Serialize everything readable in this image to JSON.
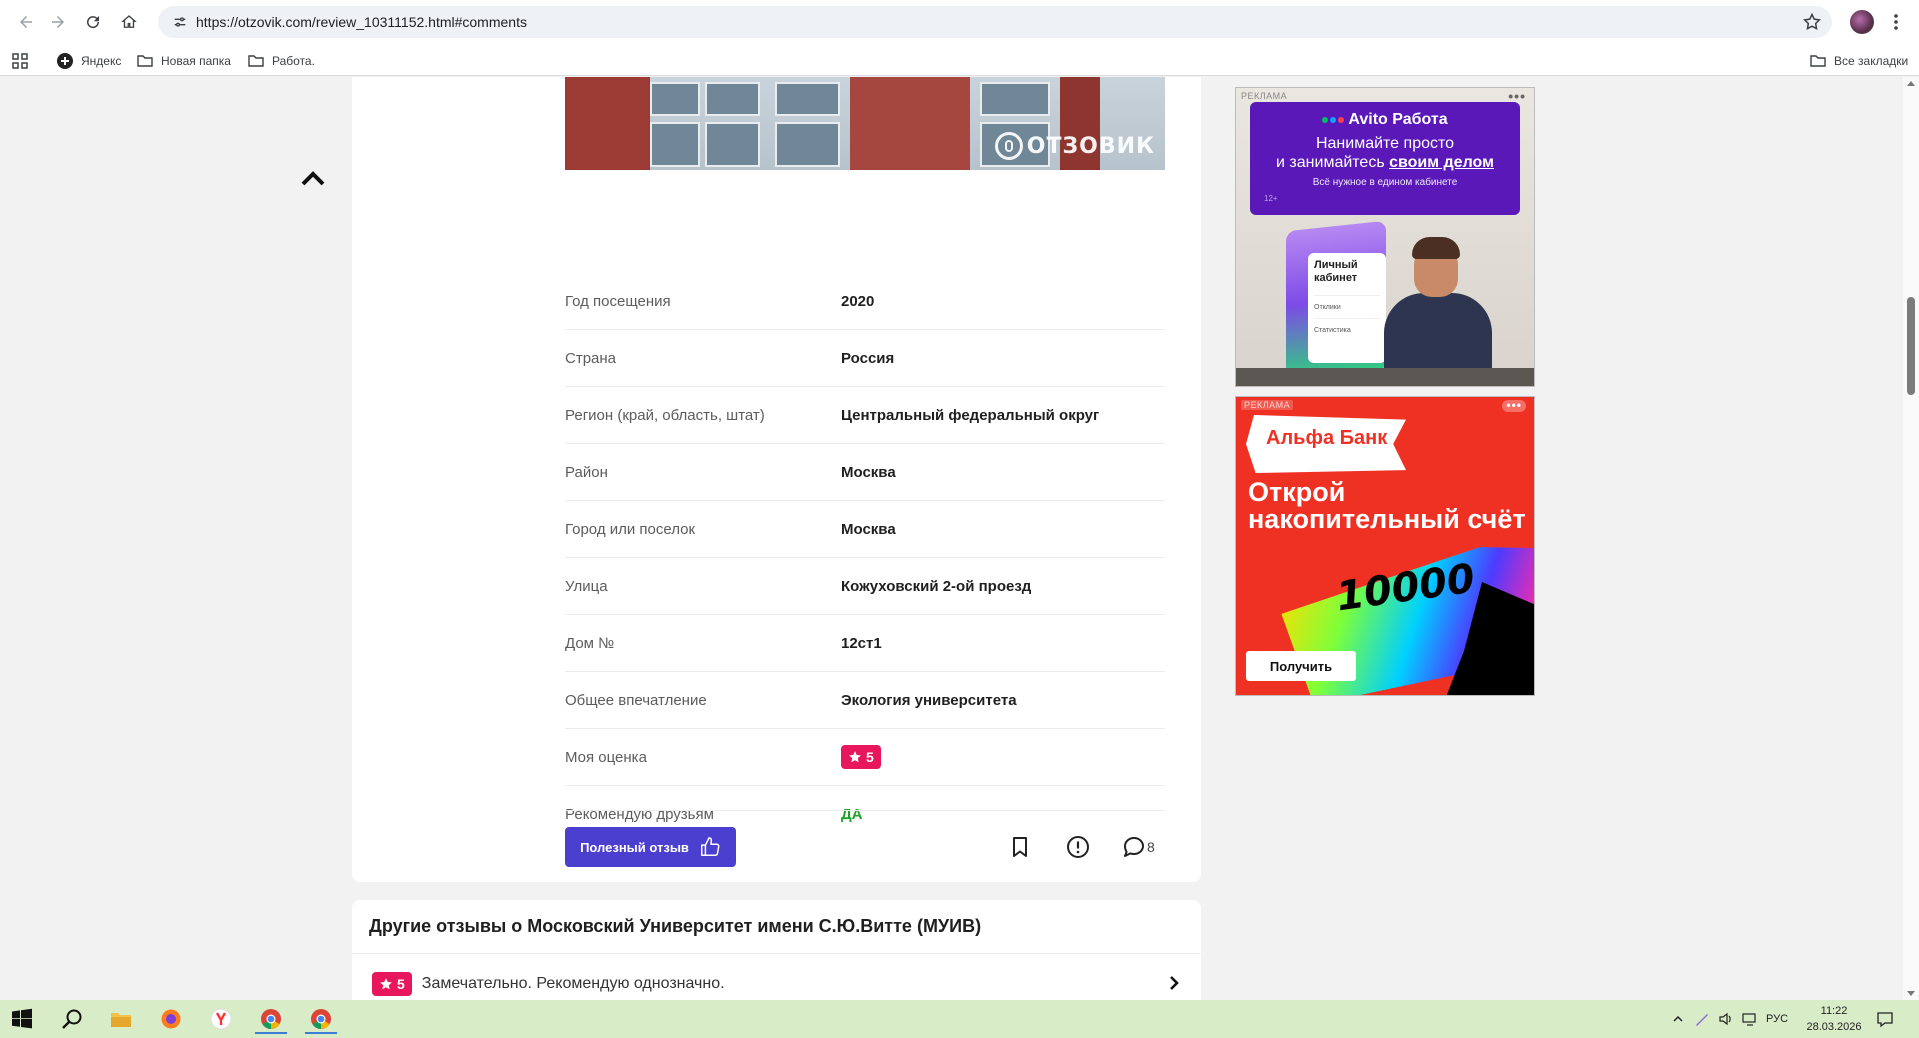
{
  "browser": {
    "url": "https://otzovik.com/review_10311152.html#comments",
    "bookmarks": [
      "Яндекс",
      "Новая папка",
      "Работа."
    ],
    "all_bookmarks": "Все закладки"
  },
  "hero": {
    "watermark": "ОТЗОВИК"
  },
  "details": [
    {
      "label": "Год посещения",
      "value": "2020"
    },
    {
      "label": "Страна",
      "value": "Россия"
    },
    {
      "label": "Регион (край, область, штат)",
      "value": "Центральный федеральный округ"
    },
    {
      "label": "Район",
      "value": "Москва"
    },
    {
      "label": "Город или поселок",
      "value": "Москва"
    },
    {
      "label": "Улица",
      "value": "Кожуховский 2-ой проезд"
    },
    {
      "label": "Дом №",
      "value": "12ст1"
    },
    {
      "label": "Общее впечатление",
      "value": "Экология университета"
    },
    {
      "label": "Моя оценка",
      "value": "5"
    },
    {
      "label": "Рекомендую друзьям",
      "value": "ДА"
    }
  ],
  "actions": {
    "useful_label": "Полезный отзыв",
    "comments_count": "8"
  },
  "other_reviews": {
    "title": "Другие отзывы о Московский Университет имени С.Ю.Витте (МУИВ)",
    "items": [
      {
        "rating": "5",
        "text": "Замечательно. Рекомендую однозначно."
      }
    ]
  },
  "ads": {
    "label": "РЕКЛАМА",
    "avito": {
      "brand": "Avito Работа",
      "headline_line1": "Нанимайте просто",
      "headline_line2": "и занимайтесь",
      "headline_emph": "своим делом",
      "sub": "Всё нужное в едином кабинете",
      "age": "12+",
      "card_title": "Личный кабинет",
      "card_item1": "Отклики",
      "card_item2": "Статистика"
    },
    "alfa": {
      "brand": "Альфа Банк",
      "headline": "Открой накопительный счёт",
      "amount": "10000",
      "button": "Получить"
    }
  },
  "taskbar": {
    "lang": "РУС",
    "time": "11:22",
    "date": "28.03.2026"
  },
  "colors": {
    "accent_purple": "#4b3fcf",
    "rating_pink": "#e8175d",
    "recommend_green": "#1ea32a",
    "alfa_red": "#ef3124",
    "avito_purple": "#5a18b8"
  }
}
